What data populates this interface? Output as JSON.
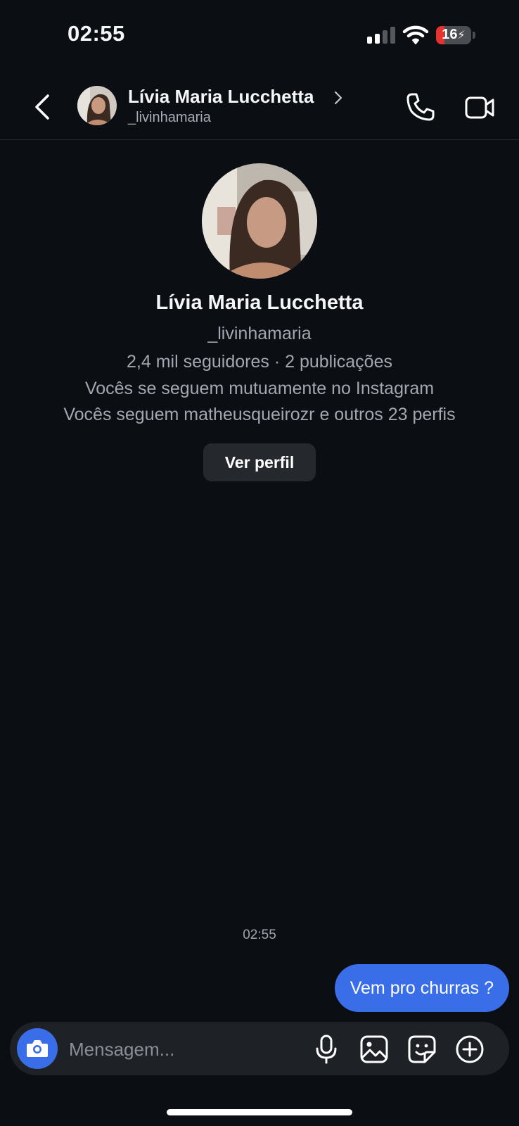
{
  "status_bar": {
    "time": "02:55",
    "battery_percent": "16",
    "battery_level": 0.16,
    "signal_bars_active": 2,
    "signal_bars_total": 4,
    "battery_color": "#e5342f"
  },
  "header": {
    "name": "Lívia Maria Lucchetta",
    "handle": "_livinhamaria",
    "back_icon": "chevron-left-icon",
    "call_icon": "phone-icon",
    "video_icon": "video-camera-icon"
  },
  "profile": {
    "name": "Lívia Maria Lucchetta",
    "handle": "_livinhamaria",
    "stats": "2,4 mil seguidores · 2 publicações",
    "mutual": "Vocês se seguem mutuamente no Instagram",
    "common_follows": "Vocês seguem matheusqueirozr e outros 23 perfis",
    "view_profile_label": "Ver perfil"
  },
  "conversation": {
    "timestamp": "02:55",
    "messages": [
      {
        "sender": "me",
        "text": "Vem pro churras ?"
      }
    ]
  },
  "composer": {
    "placeholder": "Mensagem...",
    "icons": [
      "camera-icon",
      "microphone-icon",
      "gallery-icon",
      "sticker-icon",
      "plus-circle-icon"
    ]
  },
  "colors": {
    "background": "#0b0e13",
    "accent": "#3a6ee8",
    "secondary_text": "#a3a8b0"
  }
}
